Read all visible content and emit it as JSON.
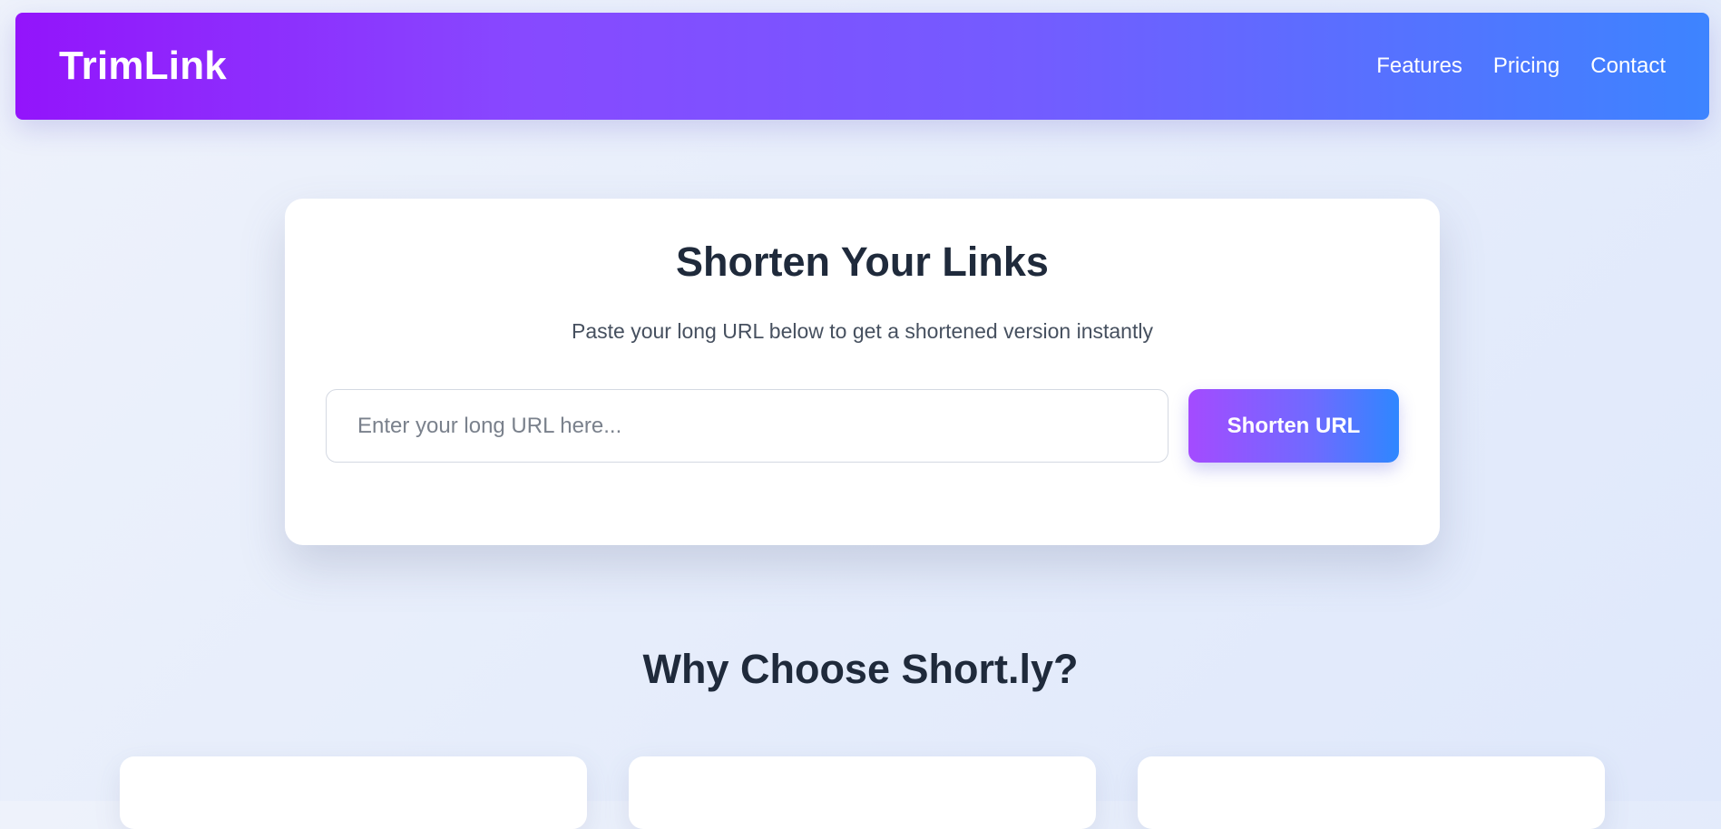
{
  "header": {
    "brand": "TrimLink",
    "nav": [
      {
        "label": "Features"
      },
      {
        "label": "Pricing"
      },
      {
        "label": "Contact"
      }
    ]
  },
  "hero": {
    "title": "Shorten Your Links",
    "subtitle": "Paste your long URL below to get a shortened version instantly",
    "input": {
      "value": "",
      "placeholder": "Enter your long URL here..."
    },
    "button_label": "Shorten URL"
  },
  "features_section": {
    "title": "Why Choose Short.ly?",
    "cards": [
      {},
      {},
      {}
    ]
  },
  "colors": {
    "header_gradient_start": "#9314fb",
    "header_gradient_end": "#3d84ff",
    "button_gradient_start": "#a44bff",
    "button_gradient_end": "#2e87ff",
    "heading_text": "#1f2a3b"
  }
}
